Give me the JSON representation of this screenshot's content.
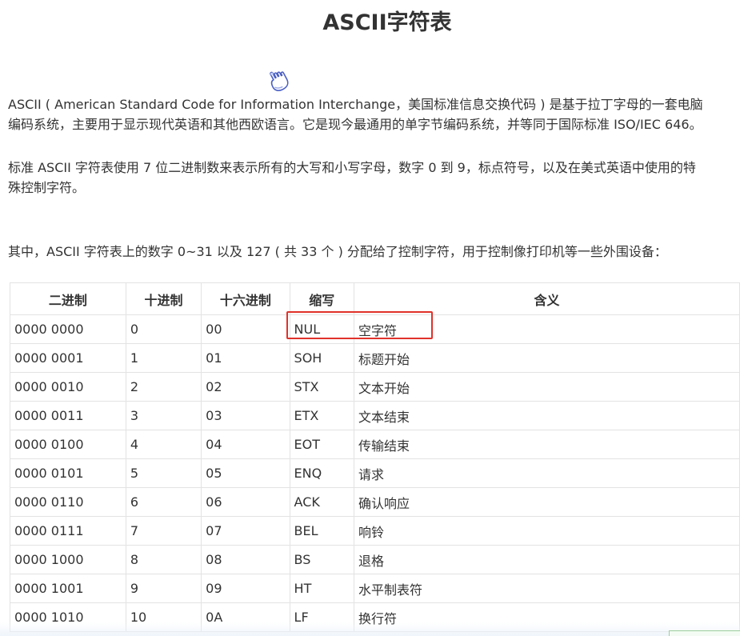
{
  "page": {
    "title": "ASCII字符表"
  },
  "icons": {
    "cursor": "hand-pointer-icon"
  },
  "paragraphs": {
    "p1_line1": "ASCII ( American Standard Code for Information Interchange，美国标准信息交换代码 ) 是基于拉丁字母的一套电脑",
    "p1_line2": "编码系统，主要用于显示现代英语和其他西欧语言。它是现今最通用的单字节编码系统，并等同于国际标准 ISO/IEC 646。",
    "p2_line1": "标准 ASCII 字符表使用 7 位二进制数来表示所有的大写和小写字母，数字 0 到 9，标点符号，以及在美式英语中使用的特",
    "p2_line2": "殊控制字符。",
    "p3": "其中，ASCII 字符表上的数字 0~31 以及 127 ( 共 33 个 ) 分配给了控制字符，用于控制像打印机等一些外围设备："
  },
  "table": {
    "headers": [
      "二进制",
      "十进制",
      "十六进制",
      "缩写",
      "含义"
    ],
    "rows": [
      [
        "0000 0000",
        "0",
        "00",
        "NUL",
        "空字符"
      ],
      [
        "0000 0001",
        "1",
        "01",
        "SOH",
        "标题开始"
      ],
      [
        "0000 0010",
        "2",
        "02",
        "STX",
        "文本开始"
      ],
      [
        "0000 0011",
        "3",
        "03",
        "ETX",
        "文本结束"
      ],
      [
        "0000 0100",
        "4",
        "04",
        "EOT",
        "传输结束"
      ],
      [
        "0000 0101",
        "5",
        "05",
        "ENQ",
        "请求"
      ],
      [
        "0000 0110",
        "6",
        "06",
        "ACK",
        "确认响应"
      ],
      [
        "0000 0111",
        "7",
        "07",
        "BEL",
        "响铃"
      ],
      [
        "0000 1000",
        "8",
        "08",
        "BS",
        "退格"
      ],
      [
        "0000 1001",
        "9",
        "09",
        "HT",
        "水平制表符"
      ],
      [
        "0000 1010",
        "10",
        "0A",
        "LF",
        "换行符"
      ]
    ]
  },
  "colors": {
    "highlight": "#e0322b",
    "text": "#333333",
    "border": "#e3e3e3",
    "icon_blue": "#5566cc"
  }
}
